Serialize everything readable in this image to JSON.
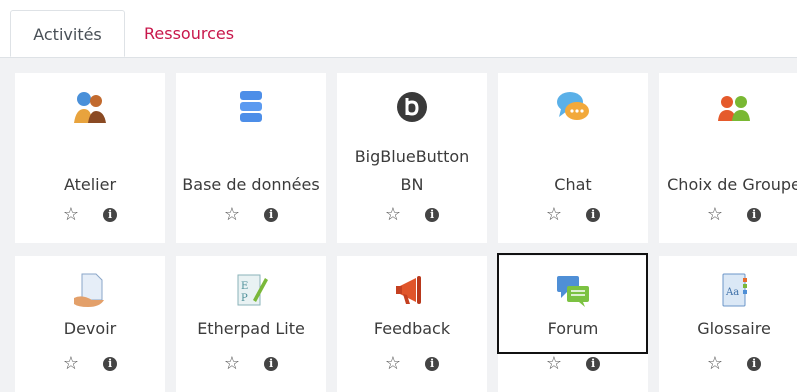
{
  "tabs": [
    {
      "label": "Activités"
    },
    {
      "label": "Ressources"
    }
  ],
  "activities": [
    {
      "label": "Atelier",
      "icon": "workshop-icon"
    },
    {
      "label": "Base de données",
      "icon": "database-icon"
    },
    {
      "label": "BigBlueButton BN",
      "icon": "bigbluebutton-icon"
    },
    {
      "label": "Chat",
      "icon": "chat-icon"
    },
    {
      "label": "Choix de Groupe",
      "icon": "group-choice-icon"
    },
    {
      "label": "Devoir",
      "icon": "assignment-icon"
    },
    {
      "label": "Etherpad Lite",
      "icon": "etherpad-icon"
    },
    {
      "label": "Feedback",
      "icon": "megaphone-icon"
    },
    {
      "label": "Forum",
      "icon": "forum-icon"
    },
    {
      "label": "Glossaire",
      "icon": "glossary-icon"
    }
  ],
  "icons": {
    "star": "☆",
    "info": "i"
  }
}
